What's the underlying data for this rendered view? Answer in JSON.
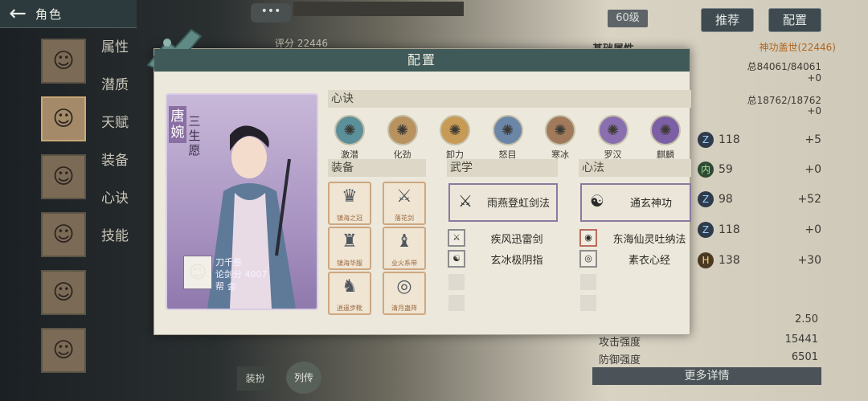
{
  "topbar": {
    "title": "角色"
  },
  "side_menu": [
    "属性",
    "潜质",
    "天赋",
    "装备",
    "心诀",
    "技能"
  ],
  "header_right": {
    "level": "60级",
    "recommend": "推荐",
    "config": "配置"
  },
  "score_top": "评分 22446",
  "base_attr": {
    "title": "基础属性",
    "power": "神功盖世(22446)",
    "hp": "总84061/84061",
    "hp_plus": "+0",
    "mp": "总18762/18762",
    "mp_plus": "+0"
  },
  "attr_rows": [
    {
      "value": "118",
      "bonus": "+5"
    },
    {
      "value": "59",
      "bonus": "+0"
    },
    {
      "value": "98",
      "bonus": "+52"
    },
    {
      "value": "118",
      "bonus": "+0"
    },
    {
      "value": "138",
      "bonus": "+30"
    }
  ],
  "bottom_stats": [
    {
      "label": "",
      "value": "2.50"
    },
    {
      "label": "攻击强度",
      "value": "15441"
    },
    {
      "label": "防御强度",
      "value": "6501"
    }
  ],
  "more_btn": "更多详情",
  "bottom_tabs": [
    "装扮",
    "列传"
  ],
  "modal": {
    "title": "配置",
    "character": {
      "name": "唐婉",
      "title": "三生愿"
    },
    "player": {
      "name": "刀千叁",
      "score": "论剑分 4007",
      "guild": "帮  会"
    },
    "xinjue_header": "心诀",
    "xinjue": [
      {
        "label": "激潜",
        "color": "#5b8f99"
      },
      {
        "label": "化劲",
        "color": "#b8925f"
      },
      {
        "label": "卸力",
        "color": "#c79a55"
      },
      {
        "label": "怒目",
        "color": "#6c86a8"
      },
      {
        "label": "寒冰",
        "color": "#a07a5a"
      },
      {
        "label": "罗汉",
        "color": "#8a6fb0"
      },
      {
        "label": "麒麟",
        "color": "#7d5fa6"
      }
    ],
    "equip_header": "装备",
    "equipment": [
      {
        "label": "镇海之冠",
        "glyph": "♛"
      },
      {
        "label": "落花剑",
        "glyph": "⚔"
      },
      {
        "label": "镇海华服",
        "glyph": "♜"
      },
      {
        "label": "业火系带",
        "glyph": "♝"
      },
      {
        "label": "逍遥步靴",
        "glyph": "♞"
      },
      {
        "label": "清月蛊阵",
        "glyph": "◎"
      }
    ],
    "wuxue_header": "武学",
    "wuxue_main": "雨燕登虹剑法",
    "wuxue_sub": [
      "疾风迅雷剑",
      "玄冰极阴指"
    ],
    "xinfa_header": "心法",
    "xinfa_main": "通玄神功",
    "xinfa_sub": [
      "东海仙灵吐纳法",
      "素衣心经"
    ]
  }
}
